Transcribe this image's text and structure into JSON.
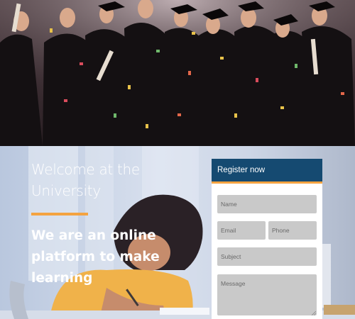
{
  "hero": {
    "image": "graduates-celebrating-photo"
  },
  "intro": {
    "welcome": "Welcome at the University",
    "tagline": "We are an online platform to make learning"
  },
  "form": {
    "title": "Register now",
    "name_placeholder": "Name",
    "email_placeholder": "Email",
    "phone_placeholder": "Phone",
    "subject_placeholder": "Subject",
    "message_placeholder": "Message"
  },
  "colors": {
    "form_header": "#154a71",
    "accent": "#f4a340",
    "field_bg": "#c9c9c9"
  }
}
